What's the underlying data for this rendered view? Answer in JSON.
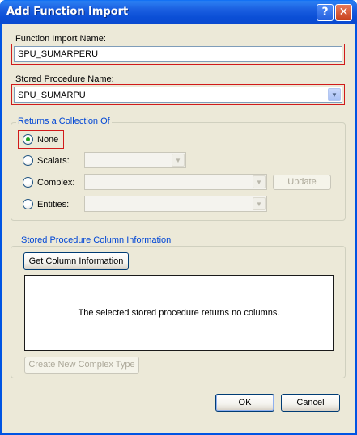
{
  "window": {
    "title": "Add Function Import"
  },
  "titlebar": {
    "help_icon": "?",
    "close_icon": "✕"
  },
  "function_import": {
    "label": "Function Import Name:",
    "value": "SPU_SUMARPERU"
  },
  "stored_procedure": {
    "label": "Stored Procedure Name:",
    "value": "SPU_SUMARPU"
  },
  "returns_group": {
    "title": "Returns a Collection Of",
    "options": [
      {
        "label": "None",
        "selected": true
      },
      {
        "label": "Scalars:",
        "selected": false
      },
      {
        "label": "Complex:",
        "selected": false
      },
      {
        "label": "Entities:",
        "selected": false
      }
    ],
    "update_label": "Update"
  },
  "column_info_group": {
    "title": "Stored Procedure Column Information",
    "get_column_label": "Get Column Information",
    "empty_message": "The selected stored procedure returns no columns.",
    "create_complex_label": "Create New Complex Type"
  },
  "footer": {
    "ok_label": "OK",
    "cancel_label": "Cancel"
  },
  "colors": {
    "title_bar": "#0a4ad0",
    "dialog_bg": "#ece9d8",
    "group_title": "#0046d5",
    "highlight_border": "#d11a1a"
  }
}
